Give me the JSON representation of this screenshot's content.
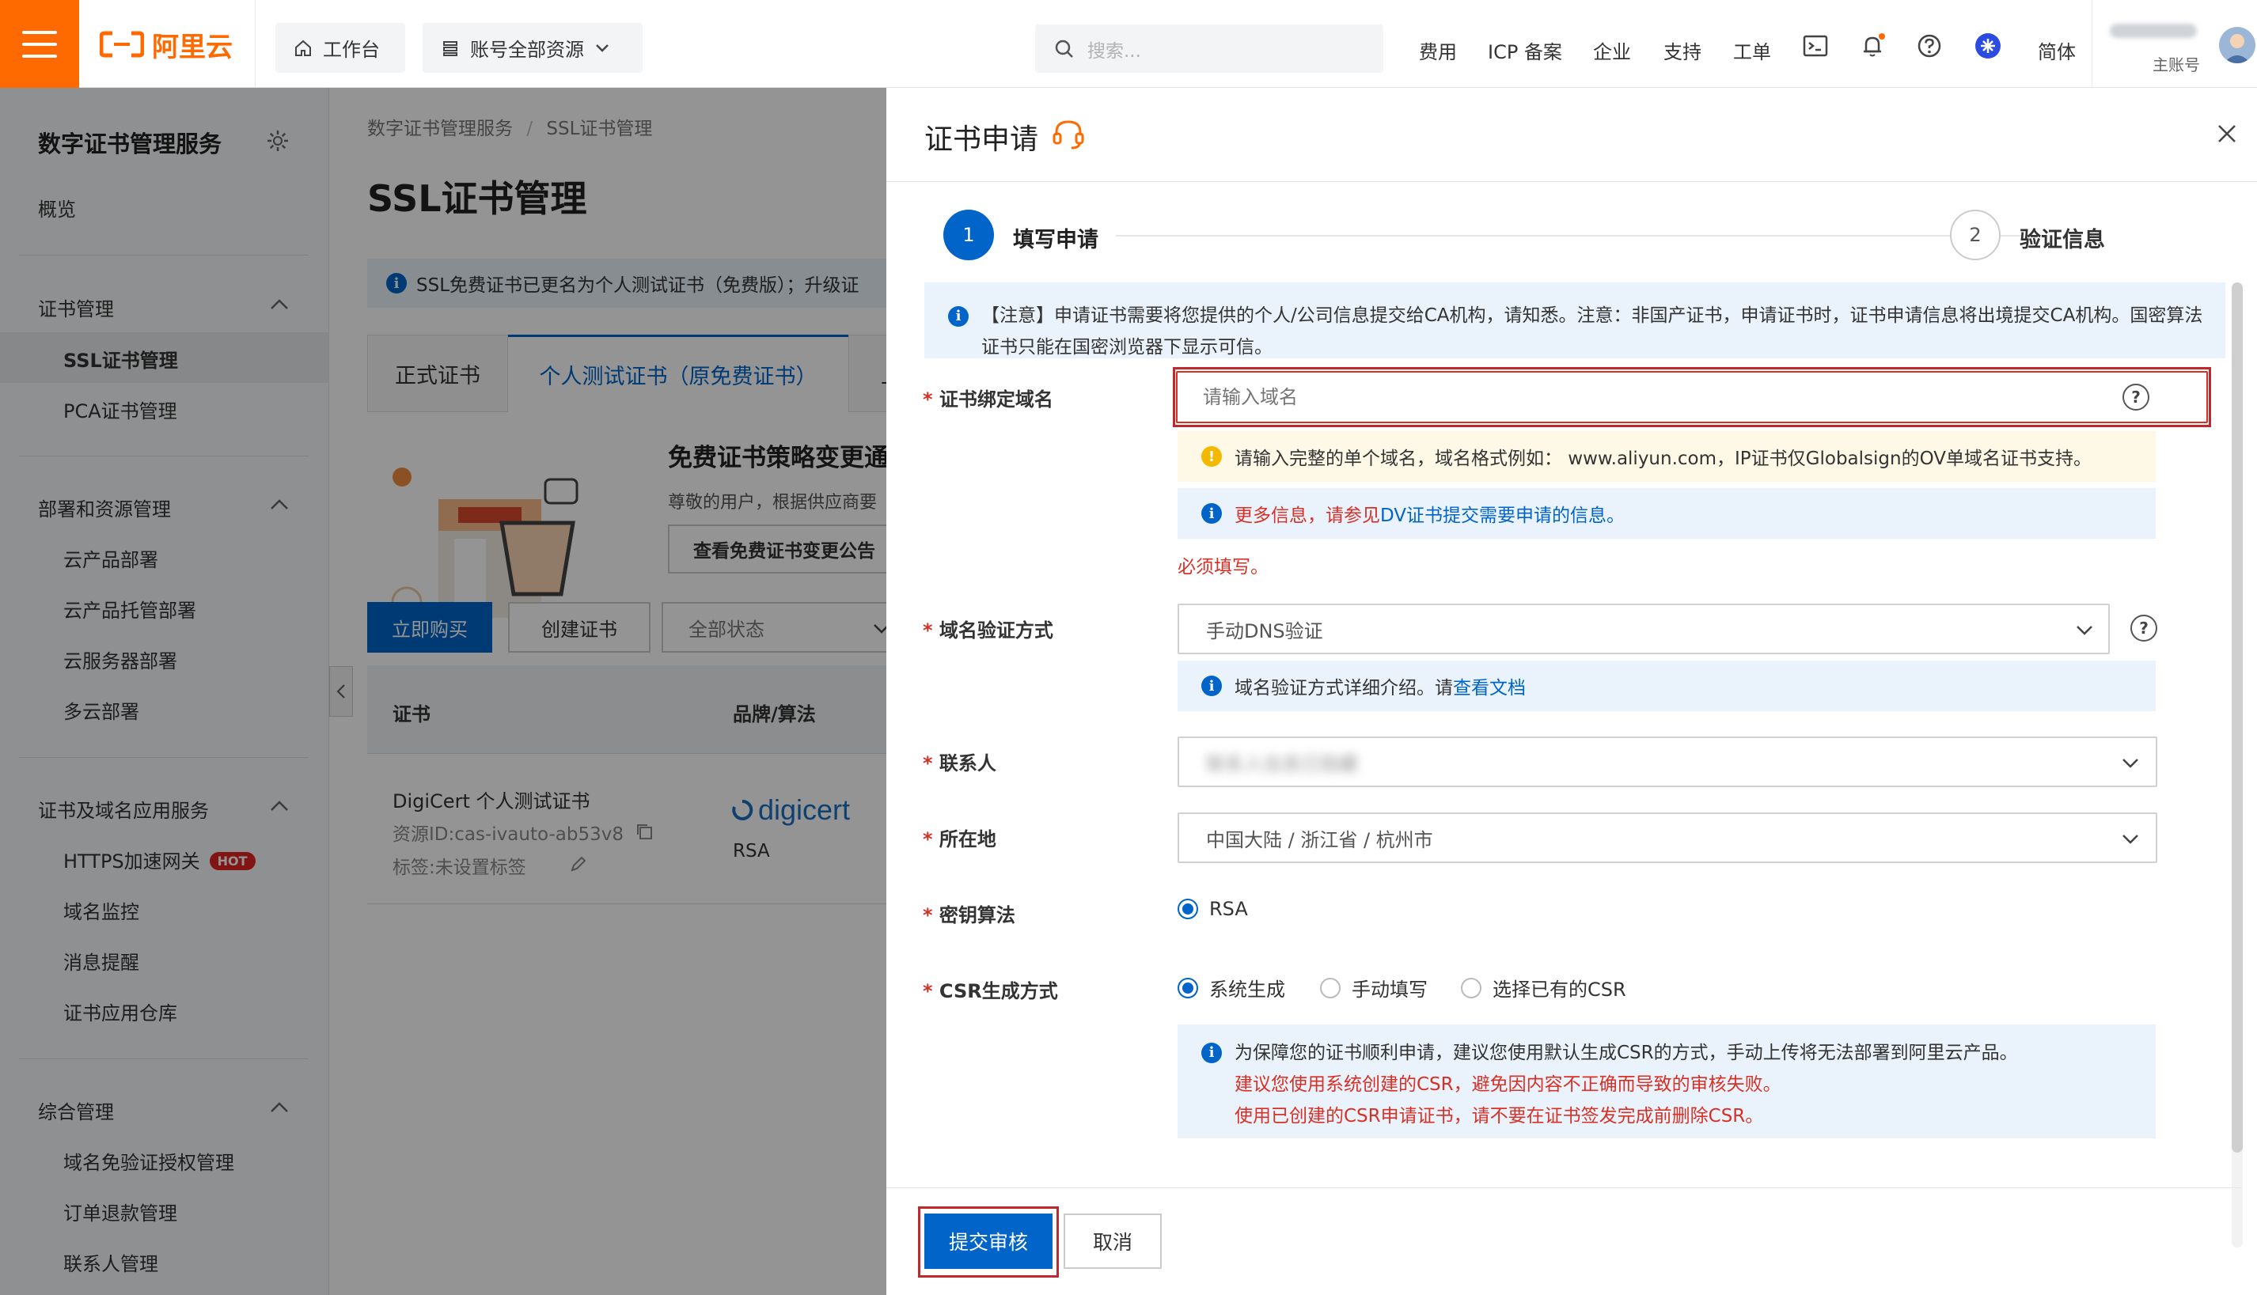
{
  "topbar": {
    "logo_text": "阿里云",
    "workbench": "工作台",
    "resources": "账号全部资源",
    "search_placeholder": "搜索...",
    "links": [
      "费用",
      "ICP 备案",
      "企业",
      "支持",
      "工单"
    ],
    "lang": "简体",
    "account_role": "主账号"
  },
  "sidebar": {
    "title": "数字证书管理服务",
    "overview": "概览",
    "groups": [
      {
        "title": "证书管理",
        "items": [
          "SSL证书管理",
          "PCA证书管理"
        ]
      },
      {
        "title": "部署和资源管理",
        "items": [
          "云产品部署",
          "云产品托管部署",
          "云服务器部署",
          "多云部署"
        ]
      },
      {
        "title": "证书及域名应用服务",
        "items": [
          "HTTPS加速网关",
          "域名监控",
          "消息提醒",
          "证书应用仓库"
        ]
      },
      {
        "title": "综合管理",
        "items": [
          "域名免验证授权管理",
          "订单退款管理",
          "联系人管理"
        ]
      }
    ],
    "hot_badge": "HOT"
  },
  "main": {
    "breadcrumb": [
      "数字证书管理服务",
      "SSL证书管理"
    ],
    "title": "SSL证书管理",
    "notice": "SSL免费证书已更名为个人测试证书（免费版）；升级证",
    "tabs": [
      "正式证书",
      "个人测试证书（原免费证书）",
      "上"
    ],
    "promo_title": "免费证书策略变更通",
    "promo_text": "尊敬的用户，根据供应商要",
    "promo_button": "查看免费证书变更公告",
    "buttons": {
      "buy": "立即购买",
      "create": "创建证书",
      "status": "全部状态"
    },
    "table_headers": [
      "证书",
      "品牌/算法"
    ],
    "row": {
      "name": "DigiCert 个人测试证书",
      "resource_id": "资源ID:cas-ivauto-ab53v8",
      "tags": "标签:未设置标签",
      "brand": "digicert",
      "algo": "RSA"
    }
  },
  "drawer": {
    "title": "证书申请",
    "steps": [
      {
        "num": "1",
        "label": "填写申请"
      },
      {
        "num": "2",
        "label": "验证信息"
      }
    ],
    "notice": "【注意】申请证书需要将您提供的个人/公司信息提交给CA机构，请知悉。注意：非国产证书，申请证书时，证书申请信息将出境提交CA机构。国密算法证书只能在国密浏览器下显示可信。",
    "domain": {
      "label": "证书绑定域名",
      "placeholder": "请输入域名",
      "warning": "请输入完整的单个域名，域名格式例如： www.aliyun.com，IP证书仅Globalsign的OV单域名证书支持。",
      "info_prefix": "更多信息，请参见",
      "info_link": "DV证书提交需要申请的信息。",
      "error": "必须填写。"
    },
    "verify": {
      "label": "域名验证方式",
      "value": "手动DNS验证",
      "info_prefix": "域名验证方式详细介绍。请",
      "info_link": "查看文档"
    },
    "contact": {
      "label": "联系人",
      "value": "联系人信息已隐藏"
    },
    "location": {
      "label": "所在地",
      "value": "中国大陆 / 浙江省 / 杭州市"
    },
    "key_algo": {
      "label": "密钥算法",
      "option": "RSA"
    },
    "csr": {
      "label": "CSR生成方式",
      "options": [
        "系统生成",
        "手动填写",
        "选择已有的CSR"
      ],
      "info_line1": "为保障您的证书顺利申请，建议您使用默认生成CSR的方式，手动上传将无法部署到阿里云产品。",
      "info_line2": "建议您使用系统创建的CSR，避免因内容不正确而导致的审核失败。",
      "info_line3": "使用已创建的CSR申请证书，请不要在证书签发完成前删除CSR。"
    },
    "footer": {
      "submit": "提交审核",
      "cancel": "取消"
    }
  },
  "colors": {
    "brand_orange": "#ff6a00",
    "primary_blue": "#0064c8",
    "error_red": "#d93026",
    "highlight_box": "#c0282d"
  }
}
